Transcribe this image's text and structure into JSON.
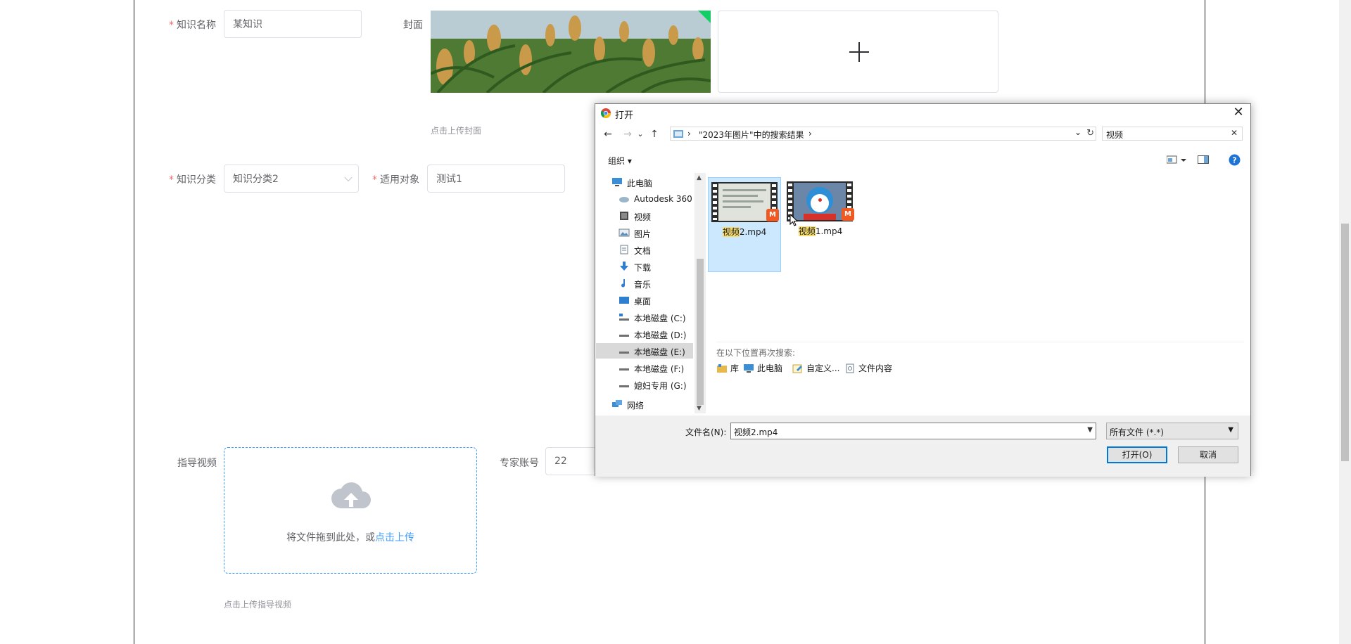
{
  "form": {
    "name_label": "知识名称",
    "name_value": "某知识",
    "cover_label": "封面",
    "cover_tip": "点击上传封面",
    "category_label": "知识分类",
    "category_value": "知识分类2",
    "target_label": "适用对象",
    "target_value": "测试1",
    "video_label": "指导视频",
    "upload_text": "将文件拖到此处，或",
    "upload_link": "点击上传",
    "video_tip": "点击上传指导视频",
    "expert_label": "专家账号",
    "expert_value": "22",
    "required_mark": "*",
    "plus_symbol": "+"
  },
  "dialog": {
    "title": "打开",
    "close": "✕",
    "nav_back": "←",
    "nav_forward": "→",
    "nav_recent": "⌄",
    "nav_up": "↑",
    "address_path": "\"2023年图片\"中的搜索结果",
    "address_sep1": "›",
    "address_sep2": "›",
    "address_dropdown": "⌄",
    "refresh": "↻",
    "search_value": "视频",
    "search_clear": "✕",
    "organize": "组织 ▾",
    "help": "?",
    "tree": [
      {
        "label": "此电脑",
        "icon": "computer-icon"
      },
      {
        "label": "Autodesk 360",
        "icon": "cloud-drive-icon"
      },
      {
        "label": "视频",
        "icon": "video-folder-icon"
      },
      {
        "label": "图片",
        "icon": "picture-folder-icon"
      },
      {
        "label": "文档",
        "icon": "document-folder-icon"
      },
      {
        "label": "下载",
        "icon": "download-folder-icon"
      },
      {
        "label": "音乐",
        "icon": "music-folder-icon"
      },
      {
        "label": "桌面",
        "icon": "desktop-folder-icon"
      },
      {
        "label": "本地磁盘 (C:)",
        "icon": "system-drive-icon"
      },
      {
        "label": "本地磁盘 (D:)",
        "icon": "drive-icon"
      },
      {
        "label": "本地磁盘 (E:)",
        "icon": "drive-icon"
      },
      {
        "label": "本地磁盘 (F:)",
        "icon": "drive-icon"
      },
      {
        "label": "媳妇专用 (G:)",
        "icon": "drive-icon"
      },
      {
        "label": "网络",
        "icon": "network-icon"
      }
    ],
    "files": [
      {
        "name_hl": "视频",
        "name_rest": "2.mp4",
        "badge": "M"
      },
      {
        "name_hl": "视频",
        "name_rest": "1.mp4",
        "badge": "M"
      }
    ],
    "search_again_label": "在以下位置再次搜索:",
    "search_again_links": [
      {
        "label": "库",
        "icon": "library-icon"
      },
      {
        "label": "此电脑",
        "icon": "computer-icon"
      },
      {
        "label": "自定义...",
        "icon": "custom-folder-icon"
      },
      {
        "label": "文件内容",
        "icon": "file-content-icon"
      }
    ],
    "filename_label": "文件名(N):",
    "filename_value": "视频2.mp4",
    "filter_value": "所有文件 (*.*)",
    "open_button": "打开(O)",
    "cancel_button": "取消"
  }
}
